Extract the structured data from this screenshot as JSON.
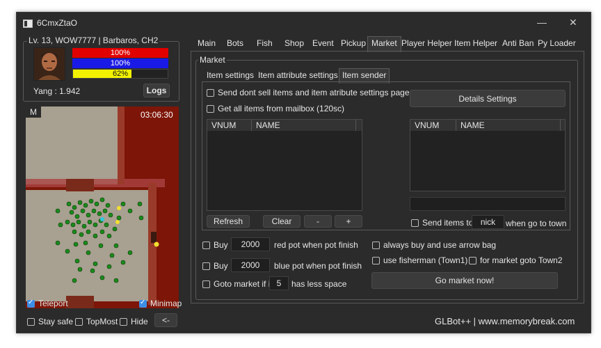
{
  "window": {
    "title": "6CmxZtaO"
  },
  "character": {
    "title": "Lv. 13, WOW7777 | Barbaros, CH2",
    "hp": "100%",
    "hp_level": 1.0,
    "sp": "100%",
    "sp_level": 1.0,
    "exp": "62%",
    "exp_level": 0.62,
    "yang": "Yang : 1.942",
    "logs_label": "Logs"
  },
  "minimap": {
    "label": "M",
    "time": "03:06:30",
    "teleport_label": "Teleport",
    "teleport_checked": true,
    "minimap_label": "Minimap",
    "minimap_checked": true
  },
  "bottom": {
    "stay_safe": "Stay safe",
    "topmost": "TopMost",
    "hide": "Hide",
    "back": "<-",
    "footer": "GLBot++ | www.memorybreak.com"
  },
  "tabs": [
    "Main",
    "Bots",
    "Fish",
    "Shop",
    "Event",
    "Pickup",
    "Market",
    "Player Helper",
    "Item Helper",
    "Anti Ban",
    "Py Loader"
  ],
  "active_tab": "Market",
  "market": {
    "group_label": "Market",
    "subtabs": [
      "Item settings",
      "Item attribute settings",
      "Item sender"
    ],
    "active_subtab": "Item sender",
    "send_dont_sell": "Send dont sell items and item atribute settings page",
    "get_mailbox": "Get all items from mailbox (120sc)",
    "details_settings": "Details Settings",
    "col_vnum": "VNUM",
    "col_name": "NAME",
    "refresh": "Refresh",
    "clear": "Clear",
    "minus": "-",
    "plus": "+",
    "send_items_to": "Send items to",
    "nick": "nick",
    "when_go_town": "when go to town",
    "buy1": "Buy",
    "red_amount": "2000",
    "red_text": "red pot when pot finish",
    "buy2": "Buy",
    "blue_amount": "2000",
    "blue_text": "blue pot when pot finish",
    "goto_market": "Goto market if i",
    "space_value": "5",
    "less_space": "has less space",
    "arrow_bag": "always buy and use arrow bag",
    "fisherman": "use fisherman (Town1)",
    "market_town2": "for market goto Town2",
    "go_market_now": "Go market now!"
  },
  "colors": {
    "hp": "#e00000",
    "sp": "#1a1ae6",
    "exp": "#f2f200",
    "accent": "#3d8ee6",
    "bg": "#2b2b2b"
  }
}
